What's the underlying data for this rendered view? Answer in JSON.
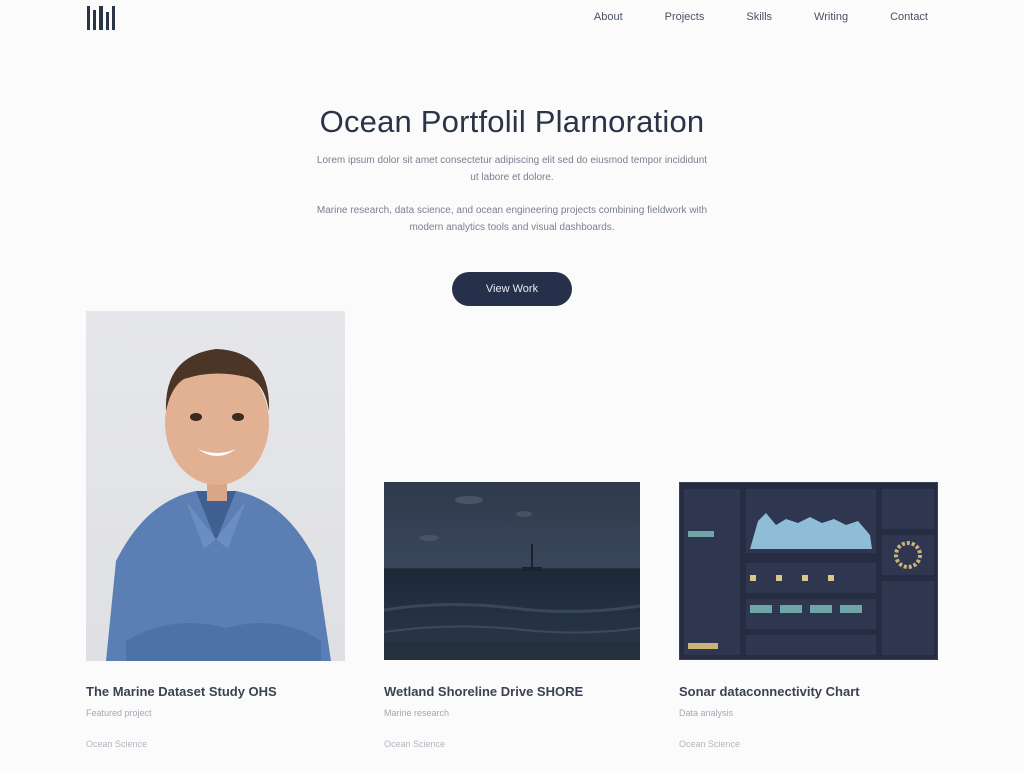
{
  "header": {
    "nav": [
      "About",
      "Projects",
      "Skills",
      "Writing",
      "Contact"
    ]
  },
  "hero": {
    "title": "Ocean Portfolil Plarnoration",
    "paragraph1": "Lorem ipsum dolor sit amet consectetur adipiscing elit sed do eiusmod tempor incididunt ut labore et dolore.",
    "paragraph2": "Marine research, data science, and ocean engineering projects combining fieldwork with modern analytics tools and visual dashboards.",
    "cta_label": "View Work"
  },
  "cards": [
    {
      "title": "The Marine Dataset Study OHS",
      "subtitle": "Featured project",
      "meta": "Ocean Science"
    },
    {
      "title": "Wetland Shoreline Drive SHORE",
      "subtitle": "Marine research",
      "meta": "Ocean Science"
    },
    {
      "title": "Sonar dataconnectivity Chart",
      "subtitle": "Data analysis",
      "meta": "Ocean Science"
    }
  ]
}
